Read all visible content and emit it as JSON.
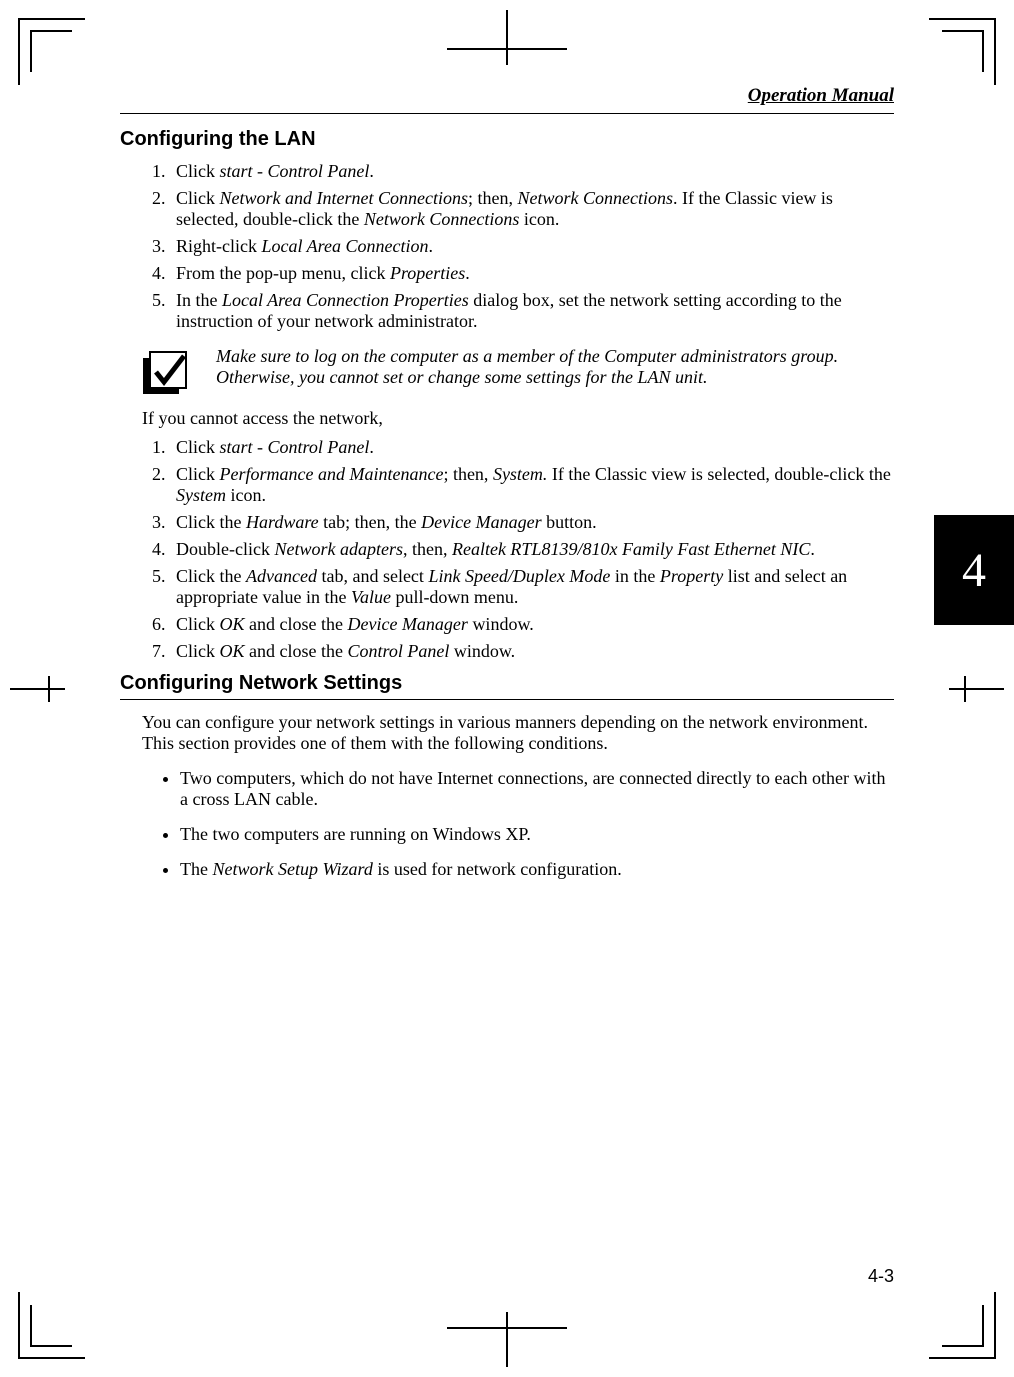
{
  "header": {
    "title": "Operation Manual"
  },
  "tab": {
    "number": "4"
  },
  "footer": {
    "page": "4-3"
  },
  "s1": {
    "heading": "Configuring the LAN",
    "l1a": "Click ",
    "l1b": "start - Control Panel",
    "l1c": ".",
    "l2a": "Click ",
    "l2b": "Network and Internet Connections",
    "l2c": "; then, ",
    "l2d": "Network Connections",
    "l2e": ". If the Classic view is selected, double-click the ",
    "l2f": "Network Connections",
    "l2g": " icon.",
    "l3a": "Right-click ",
    "l3b": "Local Area Connection",
    "l3c": ".",
    "l4a": "From the pop-up menu, click ",
    "l4b": "Properties",
    "l4c": ".",
    "l5a": "In the ",
    "l5b": "Local Area Connection Properties",
    "l5c": " dialog box, set the network setting according to the instruction of your network administrator."
  },
  "note": {
    "text": "Make sure to log on the computer as a member of the Computer administrators group. Otherwise, you cannot set or change some settings for the LAN unit."
  },
  "mid": {
    "intro": "If you cannot access the network,"
  },
  "s2": {
    "l1a": "Click ",
    "l1b": "start - Control Panel",
    "l1c": ".",
    "l2a": "Click ",
    "l2b": "Performance and Maintenance",
    "l2c": "; then, ",
    "l2d": "System.",
    "l2e": " If the Classic view is selected, double-click the ",
    "l2f": "System",
    "l2g": " icon.",
    "l3a": "Click the ",
    "l3b": "Hardware",
    "l3c": " tab; then, the ",
    "l3d": "Device Manager",
    "l3e": " button.",
    "l4a": "Double-click ",
    "l4b": "Network adapters",
    "l4c": ", then, ",
    "l4d": "Realtek RTL8139/810x Family Fast Ethernet NIC",
    "l4e": ".",
    "l5a": "Click the ",
    "l5b": "Advanced",
    "l5c": " tab, and select ",
    "l5d": "Link Speed/Duplex Mode",
    "l5e": " in the ",
    "l5f": "Property",
    "l5g": " list and select an appropriate value in the ",
    "l5h": "Value",
    "l5i": " pull-down menu.",
    "l6a": "Click ",
    "l6b": "OK",
    "l6c": " and close the ",
    "l6d": "Device Manager",
    "l6e": " window.",
    "l7a": "Click ",
    "l7b": "OK",
    "l7c": " and close the ",
    "l7d": "Control Panel",
    "l7e": " window."
  },
  "s3": {
    "heading": "Configuring Network Settings",
    "intro": "You can configure your network settings in various manners depending on the network environment. This section provides one of them with the following conditions.",
    "b1": "Two computers, which do not have Internet connections, are connected directly to each other with a cross LAN cable.",
    "b2": "The two computers are running on Windows XP.",
    "b3a": "The ",
    "b3b": "Network Setup Wizard",
    "b3c": " is used for network configuration."
  }
}
